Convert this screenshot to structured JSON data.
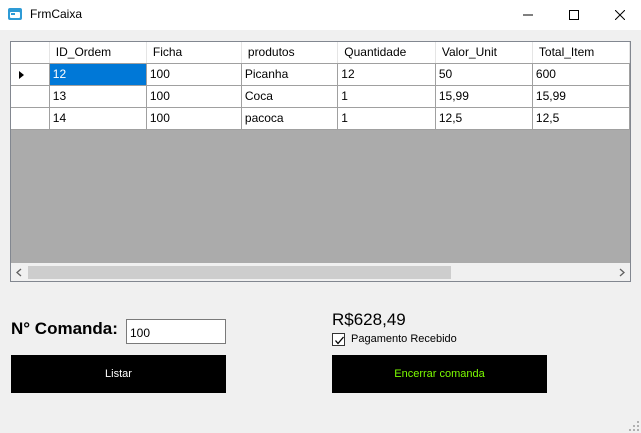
{
  "window": {
    "title": "FrmCaixa",
    "icon": "app-form-icon",
    "controls": [
      "minimize-icon",
      "maximize-icon",
      "close-icon"
    ]
  },
  "grid": {
    "columns": [
      "ID_Ordem",
      "Ficha",
      "produtos",
      "Quantidade",
      "Valor_Unit",
      "Total_Item"
    ],
    "rows": [
      [
        "12",
        "100",
        "Picanha",
        "12",
        "50",
        "600"
      ],
      [
        "13",
        "100",
        "Coca",
        "1",
        "15,99",
        "15,99"
      ],
      [
        "14",
        "100",
        "pacoca",
        "1",
        "12,5",
        "12,5"
      ]
    ],
    "selected_row": 0,
    "selected_color": "#0078d7",
    "background_color": "#ababab"
  },
  "comanda": {
    "label": "N° Comanda:",
    "value": "100"
  },
  "total": "R$628,49",
  "pagamento": {
    "label": "Pagamento Recebido",
    "checked": true
  },
  "buttons": {
    "listar": "Listar",
    "encerrar": "Encerrar comanda",
    "encerrar_color": "#7cfc00"
  }
}
